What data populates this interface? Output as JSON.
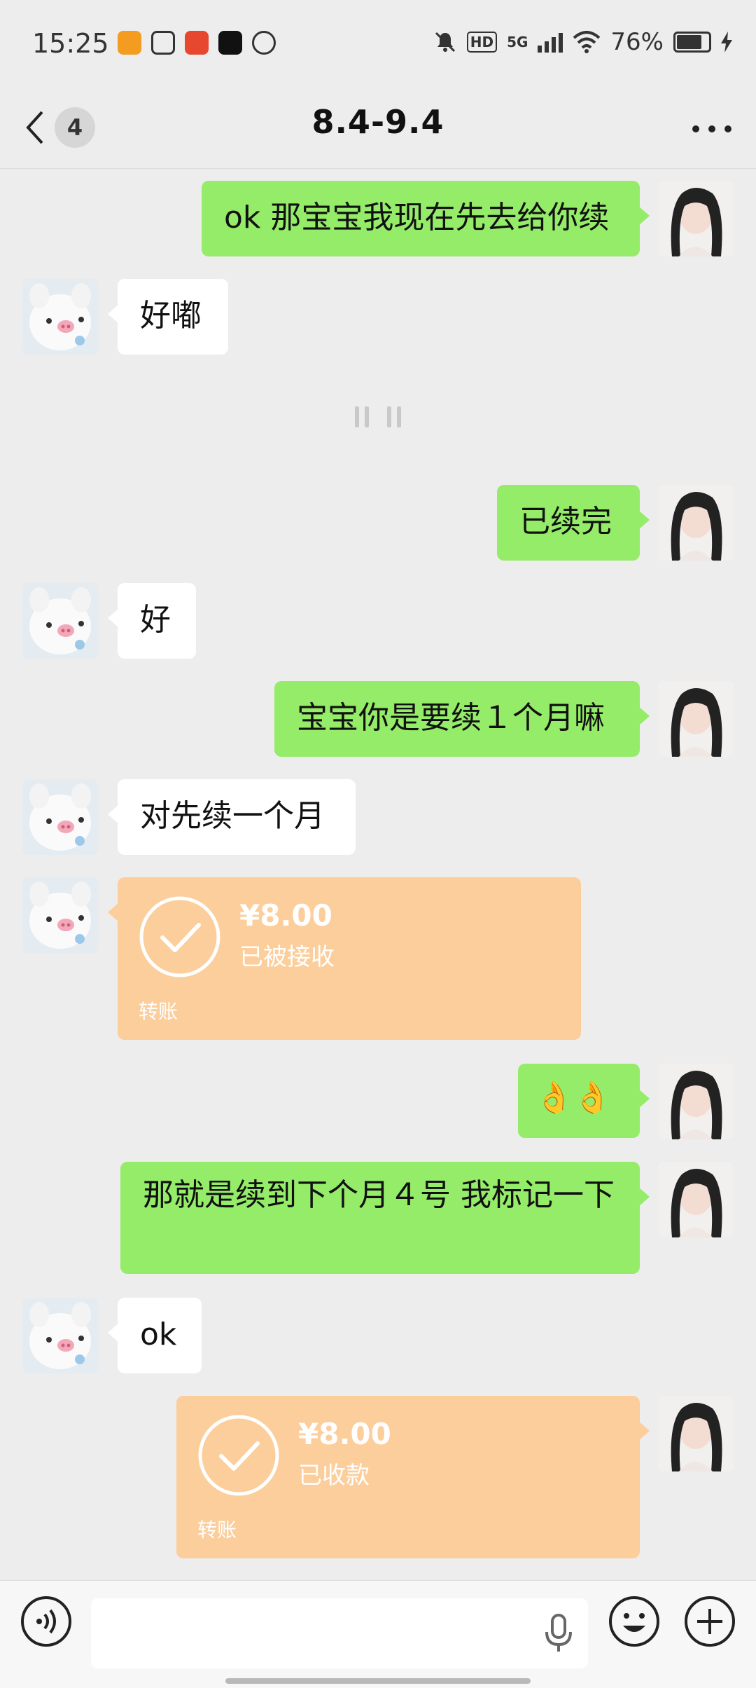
{
  "status_bar": {
    "time": "15:25",
    "network": "5G",
    "hd": "HD",
    "battery": "76%",
    "colors": {
      "app1": "#f39c1f",
      "app2": "#333333",
      "app3": "#e8472f",
      "app4": "#111111",
      "app5": "#333333"
    }
  },
  "header": {
    "unread_count": "4",
    "title": "8.4-9.4",
    "icons": {
      "back": "chevron-left-icon",
      "more": "more-dots-icon"
    }
  },
  "messages": [
    {
      "side": "right",
      "type": "text",
      "text": "ok 那宝宝我现在先去给你续"
    },
    {
      "side": "left",
      "type": "text",
      "text": "好嘟"
    },
    {
      "side": "right",
      "type": "text",
      "text": "已续完"
    },
    {
      "side": "left",
      "type": "text",
      "text": "好"
    },
    {
      "side": "right",
      "type": "text",
      "text": "宝宝你是要续１个月嘛"
    },
    {
      "side": "left",
      "type": "text",
      "text": "对先续一个月"
    },
    {
      "side": "left",
      "type": "transfer",
      "amount": "¥8.00",
      "status": "已被接收",
      "label": "转账"
    },
    {
      "side": "right",
      "type": "emoji",
      "text": "👌👌"
    },
    {
      "side": "right",
      "type": "text",
      "text": "那就是续到下个月４号 我标记一下"
    },
    {
      "side": "left",
      "type": "text",
      "text": "ok"
    },
    {
      "side": "right",
      "type": "transfer",
      "amount": "¥8.00",
      "status": "已收款",
      "label": "转账"
    }
  ],
  "input_bar": {
    "icons": {
      "voice": "voice-icon",
      "mic": "mic-icon",
      "emoji": "emoji-icon",
      "plus": "plus-icon"
    }
  },
  "colors": {
    "bubble_green": "#95ec69",
    "bubble_white": "#ffffff",
    "transfer": "#fbce9c",
    "background": "#ededed"
  }
}
